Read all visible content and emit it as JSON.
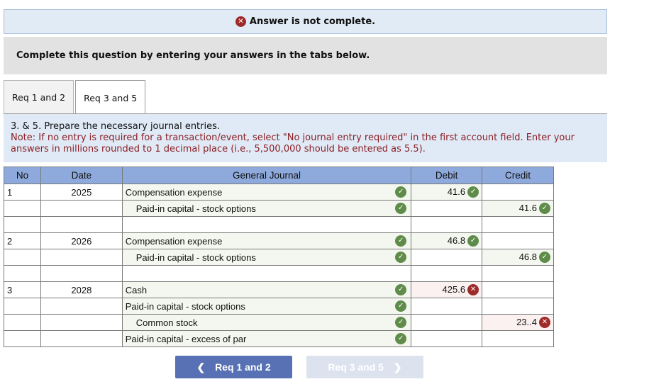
{
  "banner": {
    "icon": "error-x-icon",
    "text": "Answer is not complete."
  },
  "instruction": "Complete this question by entering your answers in the tabs below.",
  "tabs": [
    {
      "label": "Req 1 and 2",
      "active": false
    },
    {
      "label": "Req 3 and 5",
      "active": true
    }
  ],
  "prompt": {
    "question": "3. & 5. Prepare the necessary journal entries.",
    "note": "Note: If no entry is required for a transaction/event, select \"No journal entry required\" in the first account field. Enter your answers in millions rounded to 1 decimal place (i.e., 5,500,000 should be entered as 5.5)."
  },
  "table": {
    "headers": {
      "no": "No",
      "date": "Date",
      "account": "General Journal",
      "debit": "Debit",
      "credit": "Credit"
    },
    "rows": [
      {
        "no": "1",
        "date": "2025",
        "account": "Compensation expense",
        "indent": false,
        "account_status": "correct",
        "debit": "41.6",
        "debit_status": "correct",
        "credit": "",
        "credit_status": ""
      },
      {
        "no": "",
        "date": "",
        "account": "Paid-in capital - stock options",
        "indent": true,
        "account_status": "correct",
        "debit": "",
        "debit_status": "",
        "credit": "41.6",
        "credit_status": "correct"
      },
      {
        "no": "",
        "date": "",
        "account": "",
        "indent": false,
        "account_status": "",
        "debit": "",
        "debit_status": "",
        "credit": "",
        "credit_status": ""
      },
      {
        "no": "2",
        "date": "2026",
        "account": "Compensation expense",
        "indent": false,
        "account_status": "correct",
        "debit": "46.8",
        "debit_status": "correct",
        "credit": "",
        "credit_status": ""
      },
      {
        "no": "",
        "date": "",
        "account": "Paid-in capital - stock options",
        "indent": true,
        "account_status": "correct",
        "debit": "",
        "debit_status": "",
        "credit": "46.8",
        "credit_status": "correct"
      },
      {
        "no": "",
        "date": "",
        "account": "",
        "indent": false,
        "account_status": "",
        "debit": "",
        "debit_status": "",
        "credit": "",
        "credit_status": ""
      },
      {
        "no": "3",
        "date": "2028",
        "account": "Cash",
        "indent": false,
        "account_status": "correct",
        "debit": "425.6",
        "debit_status": "incorrect",
        "credit": "",
        "credit_status": ""
      },
      {
        "no": "",
        "date": "",
        "account": "Paid-in capital - stock options",
        "indent": false,
        "account_status": "correct",
        "debit": "",
        "debit_status": "",
        "credit": "",
        "credit_status": ""
      },
      {
        "no": "",
        "date": "",
        "account": "Common stock",
        "indent": true,
        "account_status": "correct",
        "debit": "",
        "debit_status": "",
        "credit": "23..4",
        "credit_status": "incorrect"
      },
      {
        "no": "",
        "date": "",
        "account": "Paid-in capital - excess of par",
        "indent": false,
        "account_status": "correct",
        "debit": "",
        "debit_status": "",
        "credit": "",
        "credit_status": ""
      }
    ]
  },
  "nav": {
    "prev_label": "Req 1 and 2",
    "next_label": "Req 3 and 5",
    "prev_icon": "chevron-left-icon",
    "next_icon": "chevron-right-icon"
  },
  "colors": {
    "correct": "#5f8c4a",
    "incorrect": "#9e2a2a",
    "header_bg": "#8eaadc",
    "primary_button": "#5771b4"
  }
}
